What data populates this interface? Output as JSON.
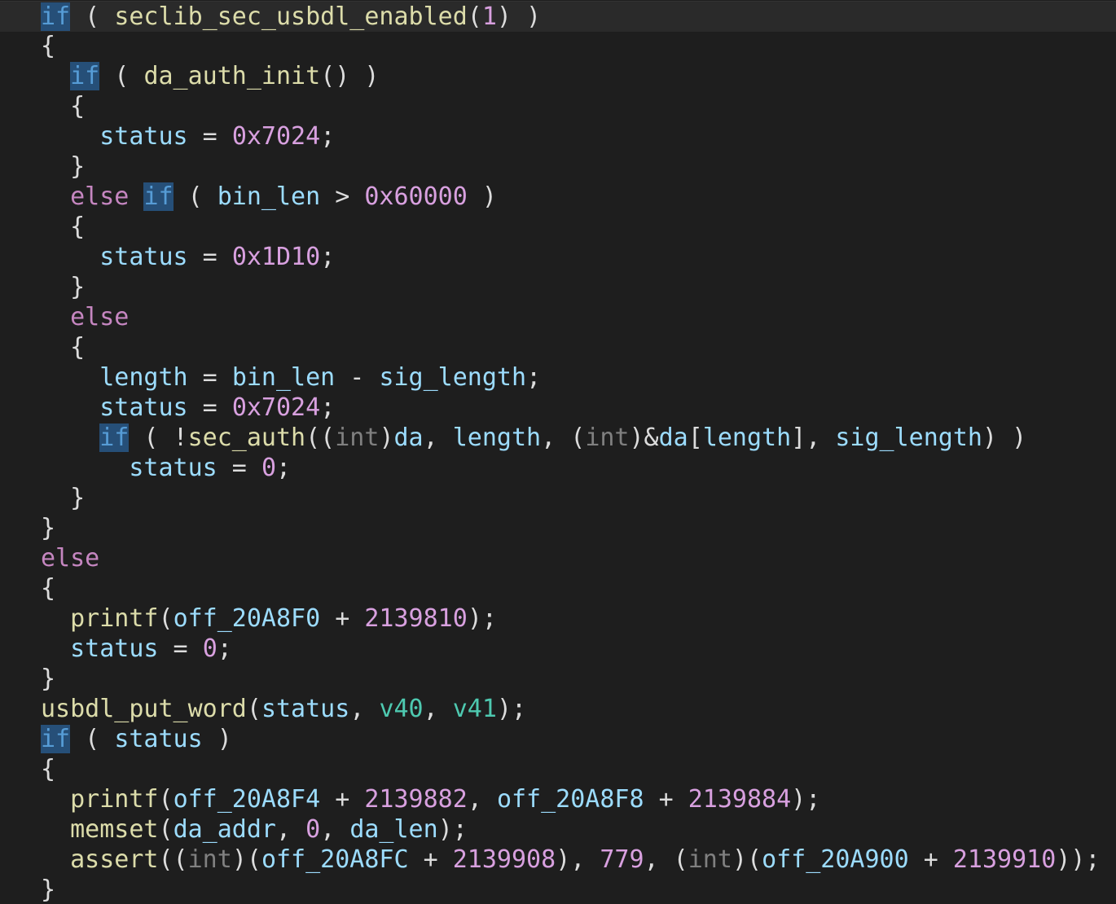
{
  "editor": {
    "lines": [
      [
        [
          "kwhl",
          "if"
        ],
        [
          "pun",
          " ( "
        ],
        [
          "fn",
          "seclib_sec_usbdl_enabled"
        ],
        [
          "pun",
          "("
        ],
        [
          "hex",
          "1"
        ],
        [
          "pun",
          ") )"
        ]
      ],
      [
        [
          "pun",
          "{"
        ]
      ],
      [
        [
          "pun",
          "  "
        ],
        [
          "kwhl",
          "if"
        ],
        [
          "pun",
          " ( "
        ],
        [
          "fn",
          "da_auth_init"
        ],
        [
          "pun",
          "() )"
        ]
      ],
      [
        [
          "pun",
          "  {"
        ]
      ],
      [
        [
          "pun",
          "    "
        ],
        [
          "id",
          "status"
        ],
        [
          "pun",
          " = "
        ],
        [
          "hex",
          "0x7024"
        ],
        [
          "pun",
          ";"
        ]
      ],
      [
        [
          "pun",
          "  }"
        ]
      ],
      [
        [
          "pun",
          "  "
        ],
        [
          "ctl",
          "else"
        ],
        [
          "pun",
          " "
        ],
        [
          "kwhl",
          "if"
        ],
        [
          "pun",
          " ( "
        ],
        [
          "id",
          "bin_len"
        ],
        [
          "pun",
          " > "
        ],
        [
          "hex",
          "0x60000"
        ],
        [
          "pun",
          " )"
        ]
      ],
      [
        [
          "pun",
          "  {"
        ]
      ],
      [
        [
          "pun",
          "    "
        ],
        [
          "id",
          "status"
        ],
        [
          "pun",
          " = "
        ],
        [
          "hex",
          "0x1D10"
        ],
        [
          "pun",
          ";"
        ]
      ],
      [
        [
          "pun",
          "  }"
        ]
      ],
      [
        [
          "pun",
          "  "
        ],
        [
          "ctl",
          "else"
        ]
      ],
      [
        [
          "pun",
          "  {"
        ]
      ],
      [
        [
          "pun",
          "    "
        ],
        [
          "id",
          "length"
        ],
        [
          "pun",
          " = "
        ],
        [
          "id",
          "bin_len"
        ],
        [
          "pun",
          " - "
        ],
        [
          "id",
          "sig_length"
        ],
        [
          "pun",
          ";"
        ]
      ],
      [
        [
          "pun",
          "    "
        ],
        [
          "id",
          "status"
        ],
        [
          "pun",
          " = "
        ],
        [
          "hex",
          "0x7024"
        ],
        [
          "pun",
          ";"
        ]
      ],
      [
        [
          "pun",
          "    "
        ],
        [
          "kwhl",
          "if"
        ],
        [
          "pun",
          " ( !"
        ],
        [
          "fn",
          "sec_auth"
        ],
        [
          "pun",
          "(("
        ],
        [
          "typ",
          "int"
        ],
        [
          "pun",
          ")"
        ],
        [
          "id",
          "da"
        ],
        [
          "pun",
          ", "
        ],
        [
          "id",
          "length"
        ],
        [
          "pun",
          ", ("
        ],
        [
          "typ",
          "int"
        ],
        [
          "pun",
          ")&"
        ],
        [
          "id",
          "da"
        ],
        [
          "pun",
          "["
        ],
        [
          "id",
          "length"
        ],
        [
          "pun",
          "], "
        ],
        [
          "id",
          "sig_length"
        ],
        [
          "pun",
          ") )"
        ]
      ],
      [
        [
          "pun",
          "      "
        ],
        [
          "id",
          "status"
        ],
        [
          "pun",
          " = "
        ],
        [
          "hex",
          "0"
        ],
        [
          "pun",
          ";"
        ]
      ],
      [
        [
          "pun",
          "  }"
        ]
      ],
      [
        [
          "pun",
          "}"
        ]
      ],
      [
        [
          "ctl",
          "else"
        ]
      ],
      [
        [
          "pun",
          "{"
        ]
      ],
      [
        [
          "pun",
          "  "
        ],
        [
          "fn",
          "printf"
        ],
        [
          "pun",
          "("
        ],
        [
          "id",
          "off_20A8F0"
        ],
        [
          "pun",
          " + "
        ],
        [
          "hex",
          "2139810"
        ],
        [
          "pun",
          ");"
        ]
      ],
      [
        [
          "pun",
          "  "
        ],
        [
          "id",
          "status"
        ],
        [
          "pun",
          " = "
        ],
        [
          "hex",
          "0"
        ],
        [
          "pun",
          ";"
        ]
      ],
      [
        [
          "pun",
          "}"
        ]
      ],
      [
        [
          "fn",
          "usbdl_put_word"
        ],
        [
          "pun",
          "("
        ],
        [
          "id",
          "status"
        ],
        [
          "pun",
          ", "
        ],
        [
          "lcl",
          "v40"
        ],
        [
          "pun",
          ", "
        ],
        [
          "lcl",
          "v41"
        ],
        [
          "pun",
          ");"
        ]
      ],
      [
        [
          "kwhl",
          "if"
        ],
        [
          "pun",
          " ( "
        ],
        [
          "id",
          "status"
        ],
        [
          "pun",
          " )"
        ]
      ],
      [
        [
          "pun",
          "{"
        ]
      ],
      [
        [
          "pun",
          "  "
        ],
        [
          "fn",
          "printf"
        ],
        [
          "pun",
          "("
        ],
        [
          "id",
          "off_20A8F4"
        ],
        [
          "pun",
          " + "
        ],
        [
          "hex",
          "2139882"
        ],
        [
          "pun",
          ", "
        ],
        [
          "id",
          "off_20A8F8"
        ],
        [
          "pun",
          " + "
        ],
        [
          "hex",
          "2139884"
        ],
        [
          "pun",
          ");"
        ]
      ],
      [
        [
          "pun",
          "  "
        ],
        [
          "fn",
          "memset"
        ],
        [
          "pun",
          "("
        ],
        [
          "id",
          "da_addr"
        ],
        [
          "pun",
          ", "
        ],
        [
          "hex",
          "0"
        ],
        [
          "pun",
          ", "
        ],
        [
          "id",
          "da_len"
        ],
        [
          "pun",
          ");"
        ]
      ],
      [
        [
          "pun",
          "  "
        ],
        [
          "fn",
          "assert"
        ],
        [
          "pun",
          "(("
        ],
        [
          "typ",
          "int"
        ],
        [
          "pun",
          ")("
        ],
        [
          "id",
          "off_20A8FC"
        ],
        [
          "pun",
          " + "
        ],
        [
          "hex",
          "2139908"
        ],
        [
          "pun",
          "), "
        ],
        [
          "hex",
          "779"
        ],
        [
          "pun",
          ", ("
        ],
        [
          "typ",
          "int"
        ],
        [
          "pun",
          ")("
        ],
        [
          "id",
          "off_20A900"
        ],
        [
          "pun",
          " + "
        ],
        [
          "hex",
          "2139910"
        ],
        [
          "pun",
          "));"
        ]
      ],
      [
        [
          "pun",
          "}"
        ]
      ]
    ]
  }
}
